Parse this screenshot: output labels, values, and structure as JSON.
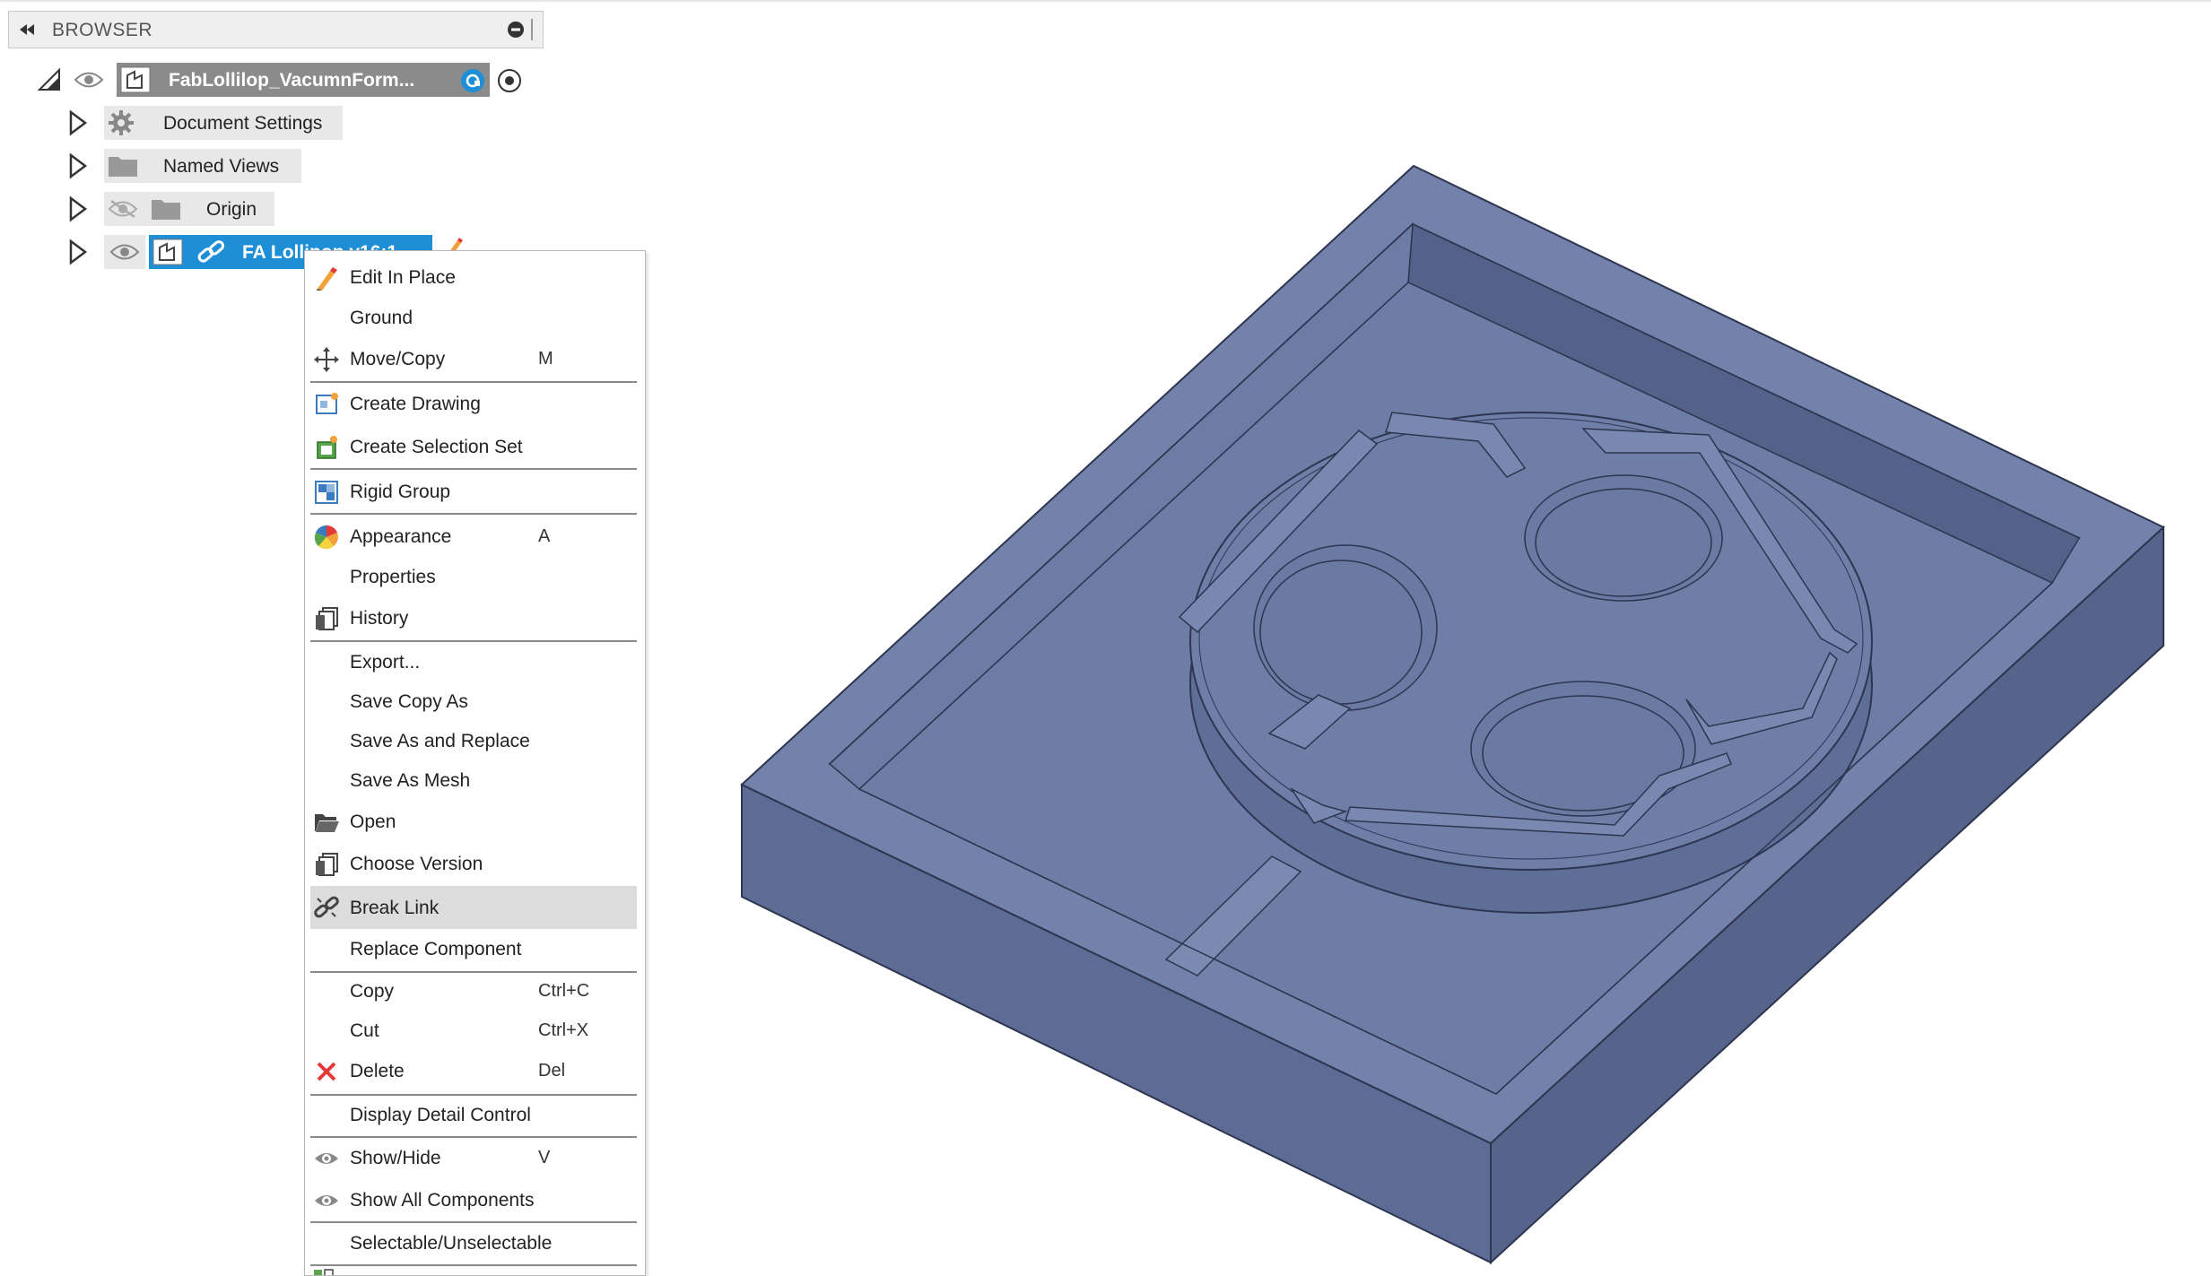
{
  "browser": {
    "title": "BROWSER",
    "root": {
      "label": "FabLollilop_VacumnForm..."
    },
    "items": [
      {
        "label": "Document Settings"
      },
      {
        "label": "Named Views"
      },
      {
        "label": "Origin"
      },
      {
        "label": "FA Lollipop v16:1"
      }
    ]
  },
  "context_menu": {
    "items": [
      {
        "label": "Edit In Place",
        "shortcut": ""
      },
      {
        "label": "Ground",
        "shortcut": ""
      },
      {
        "label": "Move/Copy",
        "shortcut": "M"
      },
      {
        "label": "Create Drawing",
        "shortcut": ""
      },
      {
        "label": "Create Selection Set",
        "shortcut": ""
      },
      {
        "label": "Rigid Group",
        "shortcut": ""
      },
      {
        "label": "Appearance",
        "shortcut": "A"
      },
      {
        "label": "Properties",
        "shortcut": ""
      },
      {
        "label": "History",
        "shortcut": ""
      },
      {
        "label": "Export...",
        "shortcut": ""
      },
      {
        "label": "Save Copy As",
        "shortcut": ""
      },
      {
        "label": "Save As and Replace",
        "shortcut": ""
      },
      {
        "label": "Save As Mesh",
        "shortcut": ""
      },
      {
        "label": "Open",
        "shortcut": ""
      },
      {
        "label": "Choose Version",
        "shortcut": ""
      },
      {
        "label": "Break Link",
        "shortcut": ""
      },
      {
        "label": "Replace Component",
        "shortcut": ""
      },
      {
        "label": "Copy",
        "shortcut": "Ctrl+C"
      },
      {
        "label": "Cut",
        "shortcut": "Ctrl+X"
      },
      {
        "label": "Delete",
        "shortcut": "Del"
      },
      {
        "label": "Display Detail Control",
        "shortcut": ""
      },
      {
        "label": "Show/Hide",
        "shortcut": "V"
      },
      {
        "label": "Show All Components",
        "shortcut": ""
      },
      {
        "label": "Selectable/Unselectable",
        "shortcut": ""
      }
    ],
    "highlighted": "Break Link"
  },
  "colors": {
    "model_top": "#6f7fa6",
    "model_side": "#5b6a92",
    "selection": "#1e8fd6",
    "delete_icon": "#e53935"
  }
}
